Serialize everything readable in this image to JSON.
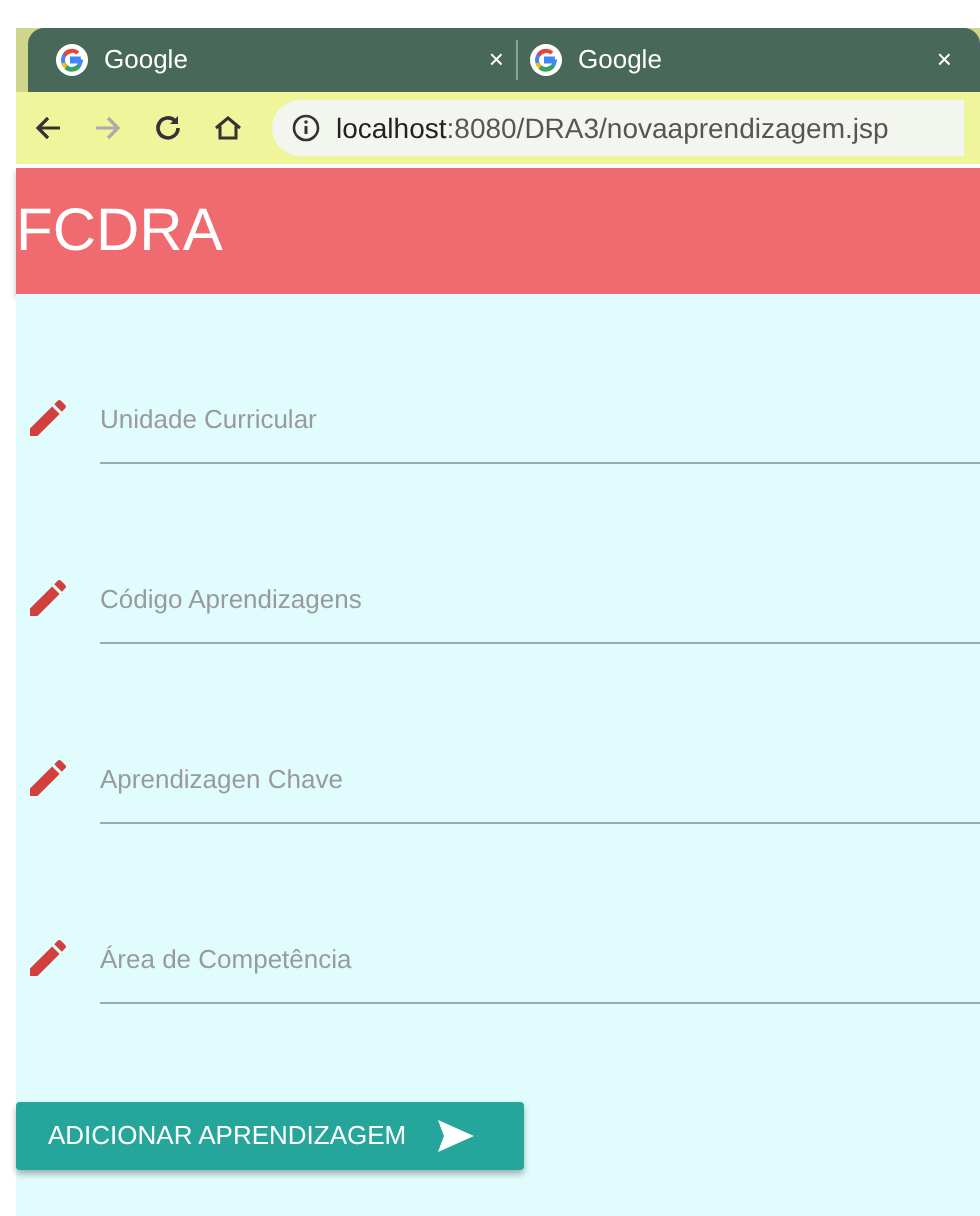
{
  "browser": {
    "tabs": [
      {
        "title": "Google",
        "close": "×"
      },
      {
        "title": "Google",
        "close": "×"
      }
    ],
    "url_host": "localhost",
    "url_path": ":8080/DRA3/novaaprendizagem.jsp"
  },
  "header": {
    "title": "FCDRA"
  },
  "fields": [
    {
      "placeholder": "Unidade Curricular"
    },
    {
      "placeholder": "Código Aprendizagens"
    },
    {
      "placeholder": "Aprendizagen Chave"
    },
    {
      "placeholder": "Área de Competência"
    }
  ],
  "submit_button": {
    "label": "ADICIONAR APRENDIZAGEM"
  }
}
